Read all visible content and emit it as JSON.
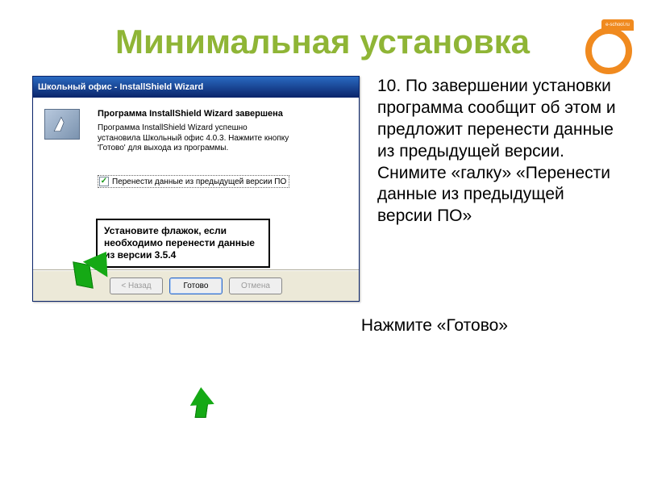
{
  "slide": {
    "title": "Минимальная установка",
    "logo_label": "e-school.ru"
  },
  "instruction": {
    "text": "10. По завершении установки программа сообщит об этом и предложит перенести данные из предыдущей версии. Снимите «галку» «Перенести данные из предыдущей версии ПО»",
    "footer": "Нажмите «Готово»"
  },
  "installer": {
    "title": "Школьный офис - InstallShield Wizard",
    "heading": "Программа InstallShield Wizard завершена",
    "description": "Программа InstallShield Wizard успешно установила Школьный офис 4.0.3. Нажмите кнопку 'Готово' для выхода из программы.",
    "checkbox": {
      "checked": true,
      "label": "Перенести данные из предыдущей версии ПО"
    },
    "callout": "Установите флажок, если необходимо перенести данные из версии 3.5.4",
    "buttons": {
      "back": "< Назад",
      "finish": "Готово",
      "cancel": "Отмена"
    }
  }
}
